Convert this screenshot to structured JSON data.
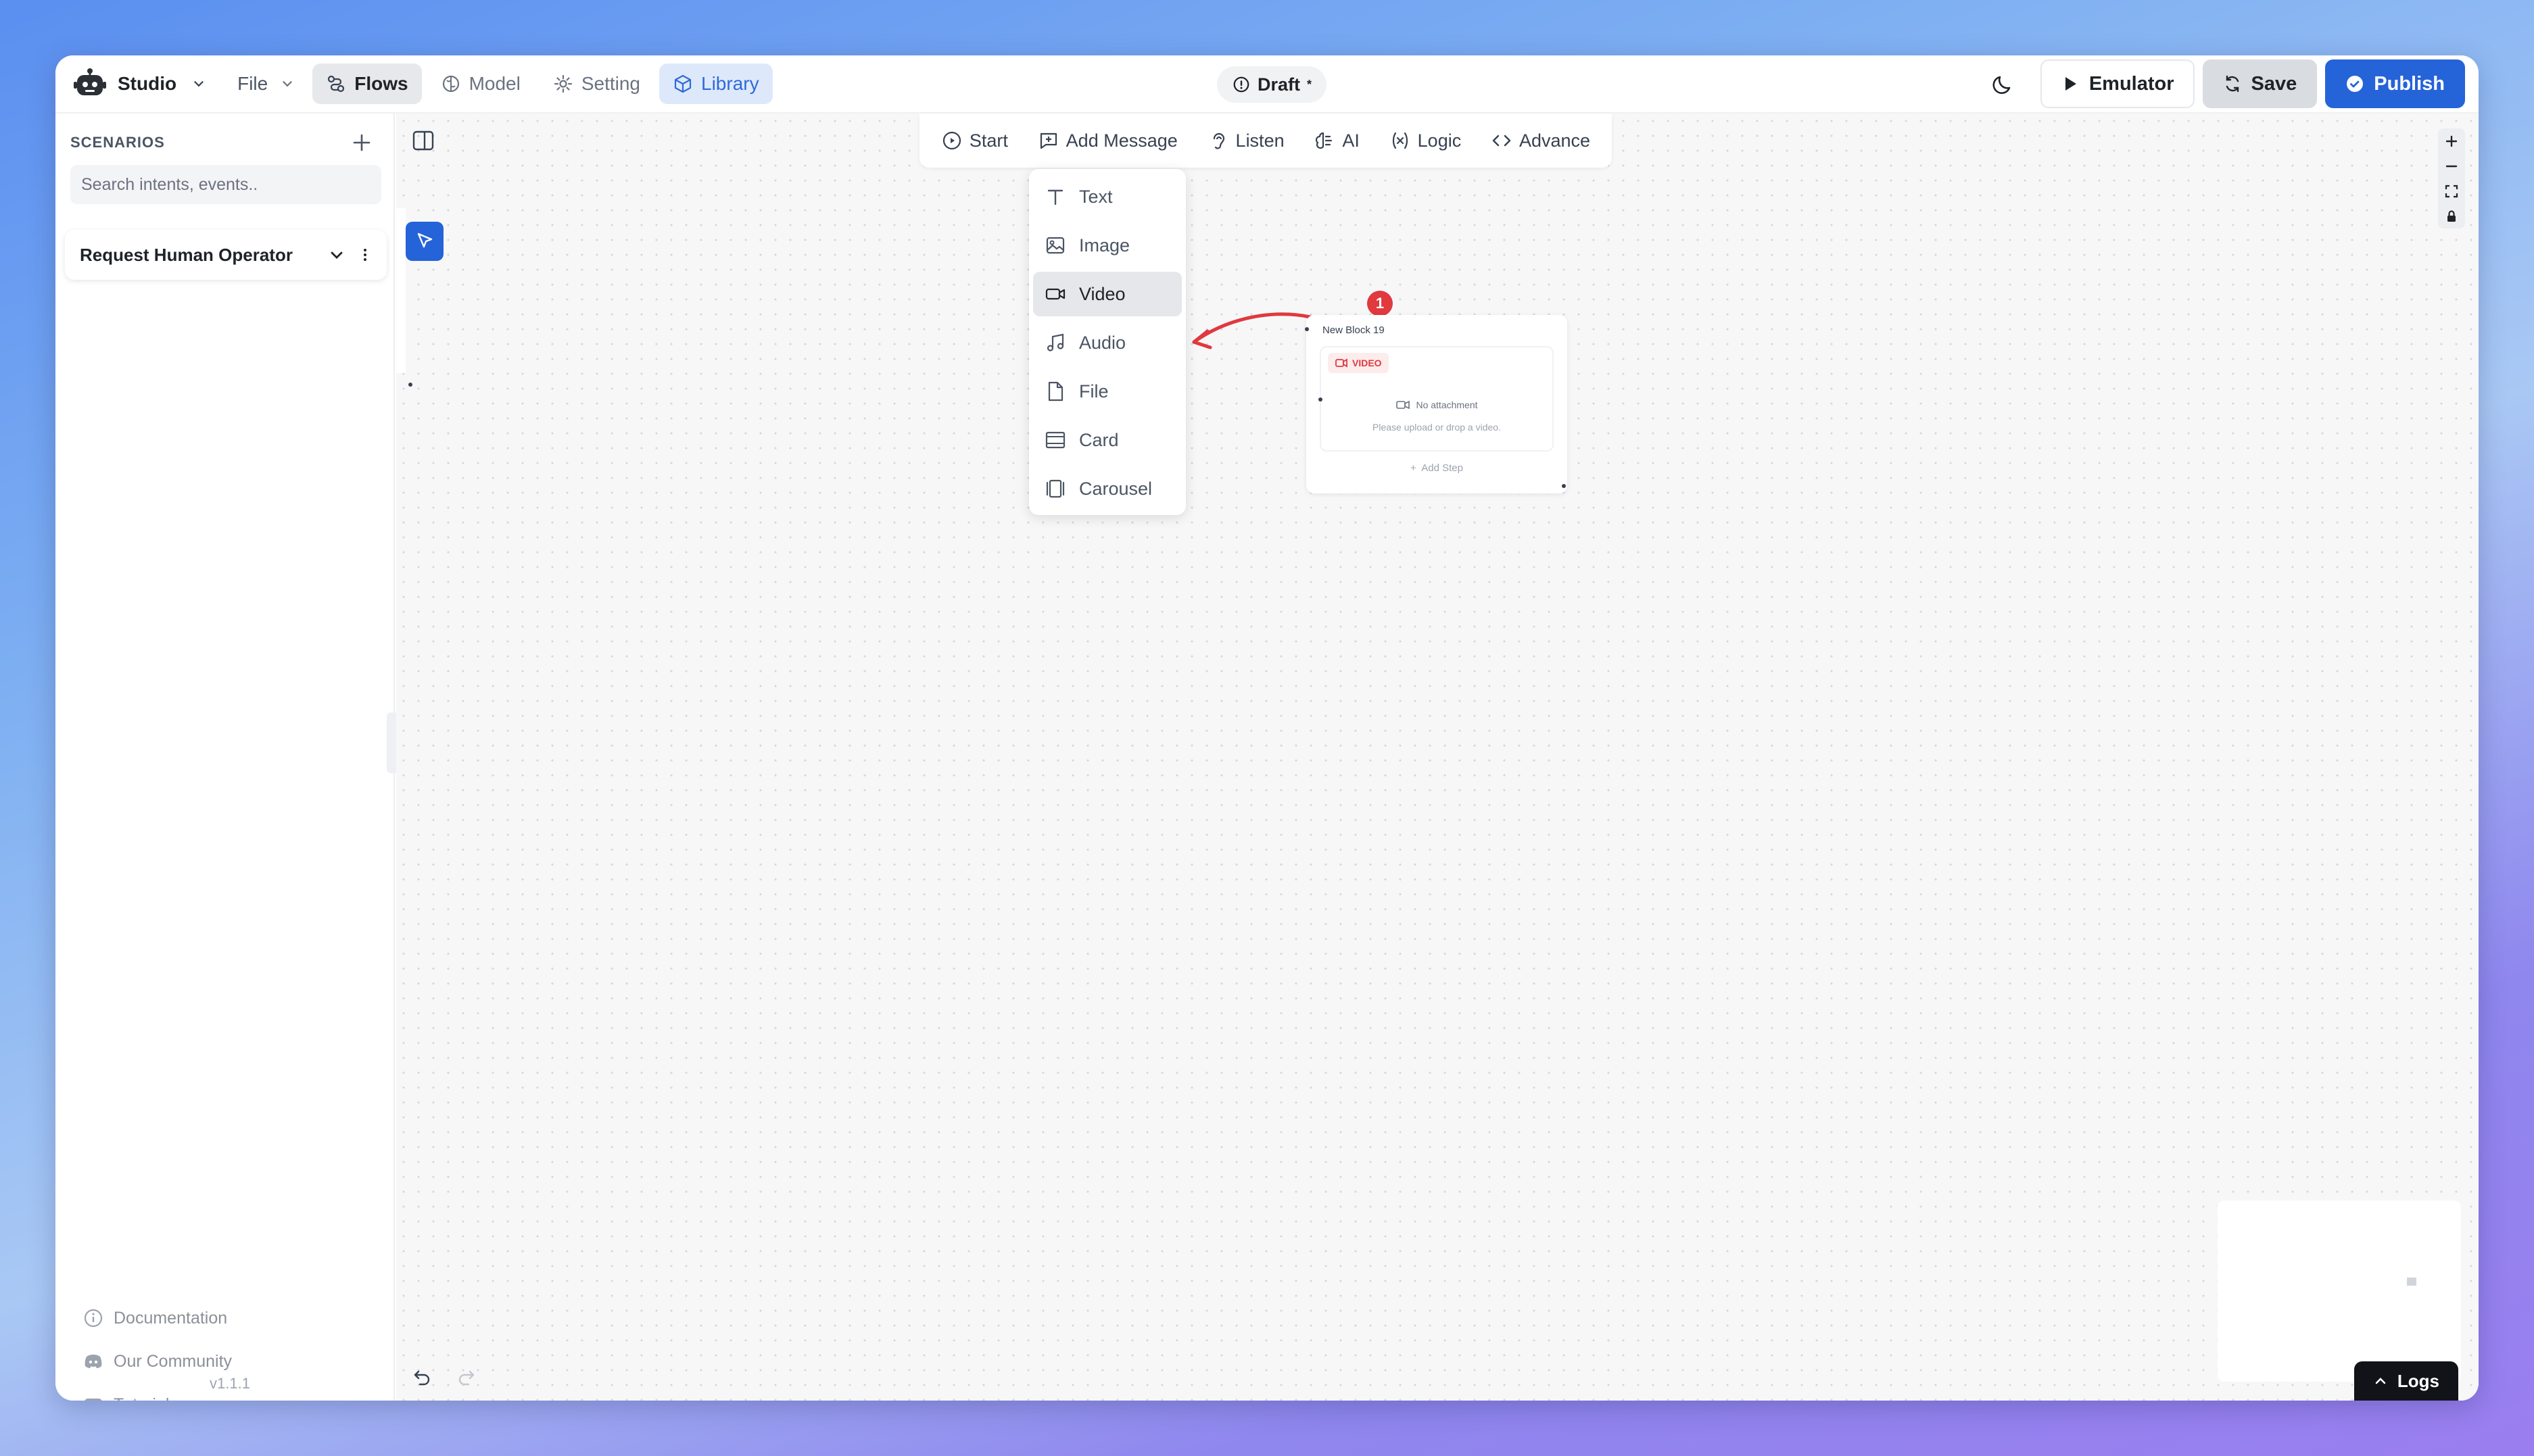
{
  "app": {
    "name": "Studio",
    "file_menu": "File",
    "status": "Draft",
    "status_mark": "*"
  },
  "nav": {
    "flows": "Flows",
    "model": "Model",
    "setting": "Setting",
    "library": "Library"
  },
  "actions": {
    "emulator": "Emulator",
    "save": "Save",
    "publish": "Publish"
  },
  "sidebar": {
    "title": "SCENARIOS",
    "search_placeholder": "Search intents, events..",
    "scenario_name": "Request Human Operator",
    "links": {
      "documentation": "Documentation",
      "community": "Our Community",
      "tutorials": "Tutorials"
    },
    "version": "v1.1.1"
  },
  "toolbar": {
    "start": "Start",
    "add_message": "Add Message",
    "listen": "Listen",
    "ai": "AI",
    "logic": "Logic",
    "advance": "Advance"
  },
  "message_menu": {
    "text": "Text",
    "image": "Image",
    "video": "Video",
    "audio": "Audio",
    "file": "File",
    "card": "Card",
    "carousel": "Carousel"
  },
  "block": {
    "title": "New Block 19",
    "badge": "VIDEO",
    "no_attachment": "No attachment",
    "upload_hint": "Please upload or drop a video.",
    "add_step": "Add Step"
  },
  "annotation": {
    "step_number": "1",
    "color": "#e0393e"
  },
  "logs": "Logs",
  "colors": {
    "primary": "#2563d8",
    "library_bg": "#dde9fb",
    "accent_red": "#e0393e"
  }
}
